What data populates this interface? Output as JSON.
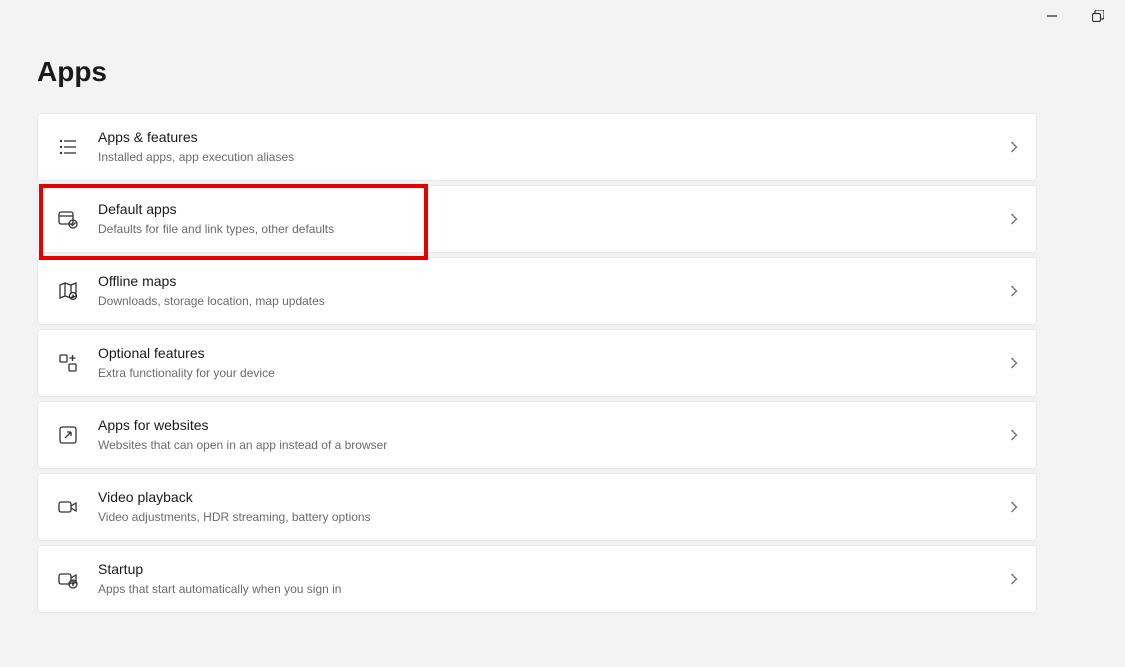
{
  "page": {
    "title": "Apps"
  },
  "items": [
    {
      "title": "Apps & features",
      "desc": "Installed apps, app execution aliases",
      "icon": "apps-features-icon"
    },
    {
      "title": "Default apps",
      "desc": "Defaults for file and link types, other defaults",
      "icon": "default-apps-icon"
    },
    {
      "title": "Offline maps",
      "desc": "Downloads, storage location, map updates",
      "icon": "offline-maps-icon"
    },
    {
      "title": "Optional features",
      "desc": "Extra functionality for your device",
      "icon": "optional-features-icon"
    },
    {
      "title": "Apps for websites",
      "desc": "Websites that can open in an app instead of a browser",
      "icon": "apps-websites-icon"
    },
    {
      "title": "Video playback",
      "desc": "Video adjustments, HDR streaming, battery options",
      "icon": "video-playback-icon"
    },
    {
      "title": "Startup",
      "desc": "Apps that start automatically when you sign in",
      "icon": "startup-icon"
    }
  ],
  "highlighted_index": 1
}
